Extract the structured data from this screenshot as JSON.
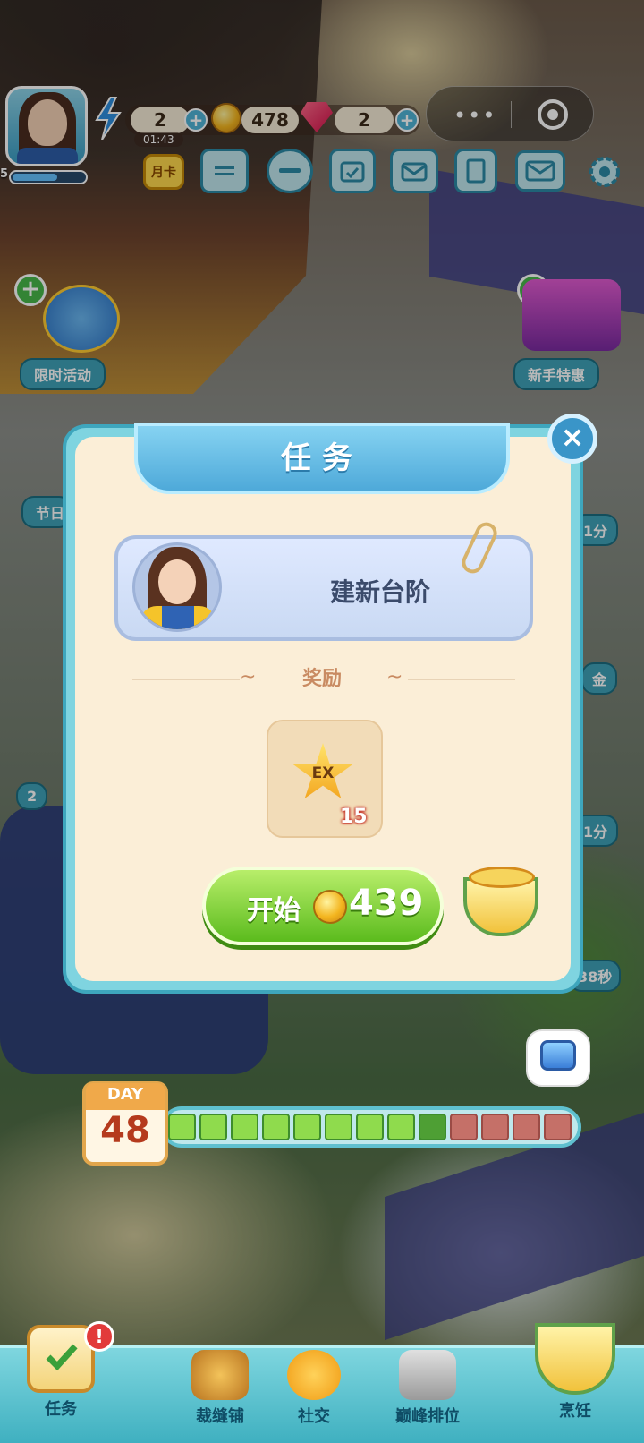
{
  "hud": {
    "level": "5",
    "energy": "2",
    "energy_timer": "01:43",
    "coins": "478",
    "gems": "2",
    "plus": "+",
    "month_card": "月卡"
  },
  "capsule": {
    "more": "•••"
  },
  "side_buttons": {
    "left": [
      {
        "label": "限时活动"
      },
      {
        "label": "节日"
      }
    ],
    "right": [
      {
        "label": "新手特惠"
      },
      {
        "label": "1分"
      },
      {
        "label": "金"
      },
      {
        "label": "1分"
      },
      {
        "label": "38秒"
      }
    ],
    "left_partial": [
      {
        "label": "2"
      }
    ]
  },
  "dialog": {
    "title": "任务",
    "close": "×",
    "task_name": "建新台阶",
    "reward_label": "奖励",
    "reward_item": {
      "icon": "ex-star-icon",
      "text": "EX",
      "count": "15"
    },
    "start_label": "开始",
    "start_cost": "439"
  },
  "day": {
    "word": "DAY",
    "number": "48",
    "segments_done": 8,
    "segments_current": 1,
    "segments_total": 13
  },
  "bottom_tabs": [
    {
      "label": "任务",
      "badge": "!"
    },
    {
      "label": "裁缝铺"
    },
    {
      "label": "社交"
    },
    {
      "label": "巅峰排位"
    },
    {
      "label": "烹饪"
    }
  ],
  "colors": {
    "accent": "#3fa1b8",
    "start_button": "#5bbb1d",
    "dialog_bg": "#fbeed7"
  }
}
